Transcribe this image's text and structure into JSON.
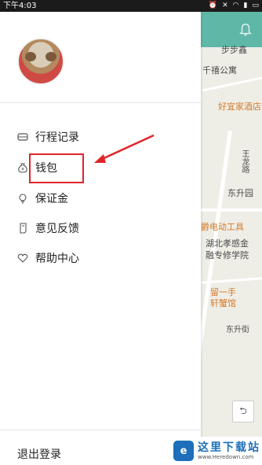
{
  "status_bar": {
    "time": "下午4:03",
    "icons": [
      "alarm-icon",
      "mute-icon",
      "wifi-icon",
      "signal-icon",
      "battery-icon"
    ]
  },
  "map": {
    "labels": [
      {
        "text": "步步鑫",
        "kind": "place"
      },
      {
        "text": "千禧公寓",
        "kind": "place"
      },
      {
        "text": "好宜家酒店",
        "kind": "poi"
      },
      {
        "text": "王龙路",
        "kind": "road"
      },
      {
        "text": "东升园",
        "kind": "place"
      },
      {
        "text": "爵电动工具",
        "kind": "poi"
      },
      {
        "text": "湖北孝感金",
        "kind": "place"
      },
      {
        "text": "融专修学院",
        "kind": "place"
      },
      {
        "text": "留一手",
        "kind": "poi"
      },
      {
        "text": "轩蟹馆",
        "kind": "poi"
      },
      {
        "text": "东升街",
        "kind": "road"
      }
    ]
  },
  "drawer": {
    "menu": [
      {
        "label": "行程记录",
        "icon": "car-icon"
      },
      {
        "label": "钱包",
        "icon": "money-bag-icon"
      },
      {
        "label": "保证金",
        "icon": "lightbulb-icon"
      },
      {
        "label": "意见反馈",
        "icon": "feedback-icon"
      },
      {
        "label": "帮助中心",
        "icon": "heart-icon"
      }
    ],
    "logout_label": "退出登录"
  },
  "watermark": {
    "title": "这里下载站",
    "url": "www.Heredown.com"
  },
  "colors": {
    "map_header": "#5fb7a8",
    "highlight": "#e0252a",
    "watermark_blue": "#1c6fb8"
  }
}
